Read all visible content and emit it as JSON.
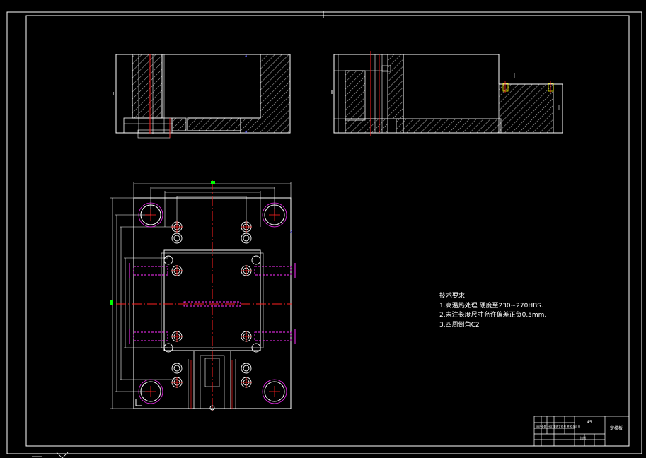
{
  "drawing": {
    "background": "#000000",
    "frame_color": "#ffffff",
    "outline_color": "#ffffff",
    "centerline_color": "#ff2020",
    "hidden_line_color": "#ff30ff",
    "marker_color": "#6060ff",
    "green_marker_color": "#00ff00"
  },
  "technical_notes": {
    "title": "技术要求:",
    "items": [
      "1.高温热处理 硬度至230~270HBS.",
      "2.未注长度尺寸允许偏差正负0.5mm.",
      "3.四周倒角C2"
    ]
  },
  "title_block": {
    "part_name": "45",
    "drawing_label": "定模板",
    "scale_label": "比例",
    "small_text": "标记 处数 分区 更改文件号 签名 年月日"
  }
}
